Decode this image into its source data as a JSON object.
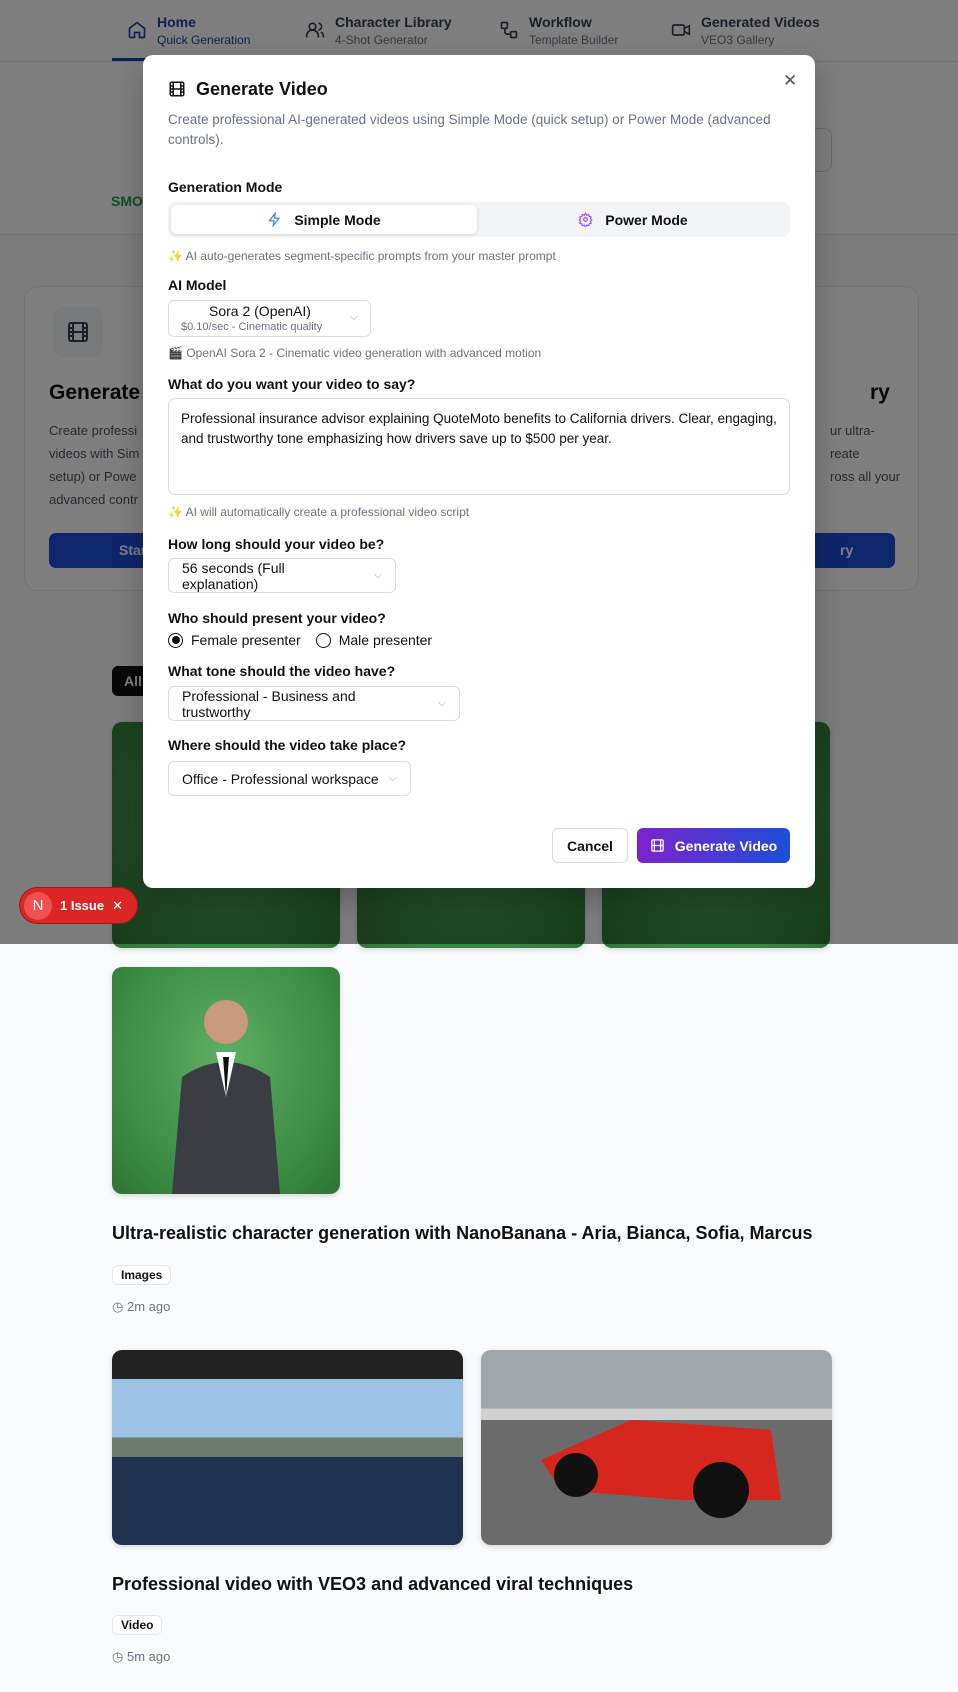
{
  "nav": {
    "items": [
      {
        "title": "Home",
        "subtitle": "Quick Generation",
        "icon": "home-icon"
      },
      {
        "title": "Character Library",
        "subtitle": "4-Shot Generator",
        "icon": "users-icon"
      },
      {
        "title": "Workflow",
        "subtitle": "Template Builder",
        "icon": "workflow-icon"
      },
      {
        "title": "Generated Videos",
        "subtitle": "VEO3 Gallery",
        "icon": "video-icon"
      }
    ]
  },
  "background": {
    "smo_text": "SMO",
    "card_title": "Generate V",
    "card_title_right": "ry",
    "card_desc": [
      "Create professi",
      "videos with Sim",
      "setup) or Powe",
      "advanced contr"
    ],
    "card_desc_right": [
      "ur ultra-",
      "reate",
      "ross all your"
    ],
    "start_button": "Star",
    "library_button": "ry",
    "filter_all": "All"
  },
  "modal": {
    "title": "Generate Video",
    "description": "Create professional AI-generated videos using Simple Mode (quick setup) or Power Mode (advanced controls).",
    "mode_label": "Generation Mode",
    "modes": [
      {
        "label": "Simple Mode",
        "active": true
      },
      {
        "label": "Power Mode",
        "active": false
      }
    ],
    "mode_hint": "AI auto-generates segment-specific prompts from your master prompt",
    "model_label": "AI Model",
    "model_name": "Sora 2 (OpenAI)",
    "model_sub": "$0.10/sec - Cinematic quality",
    "model_hint": "OpenAI Sora 2 - Cinematic video generation with advanced motion",
    "say_label": "What do you want your video to say?",
    "say_value": "Professional insurance advisor explaining QuoteMoto benefits to California drivers. Clear, engaging, and trustworthy tone emphasizing how drivers save up to $500 per year.",
    "say_hint": "AI will automatically create a professional video script",
    "duration_label": "How long should your video be?",
    "duration_value": "56 seconds (Full explanation)",
    "presenter_label": "Who should present your video?",
    "presenters": [
      {
        "label": "Female presenter",
        "checked": true
      },
      {
        "label": "Male presenter",
        "checked": false
      }
    ],
    "tone_label": "What tone should the video have?",
    "tone_value": "Professional - Business and trustworthy",
    "place_label": "Where should the video take place?",
    "place_value": "Office - Professional workspace",
    "cancel": "Cancel",
    "generate": "Generate Video"
  },
  "issue": {
    "letter": "N",
    "label": "1 Issue"
  },
  "feed": [
    {
      "title": "Ultra-realistic character generation with NanoBanana - Aria, Bianca, Sofia, Marcus",
      "badge": "Images",
      "time": "2m ago"
    },
    {
      "title": "Professional video with VEO3 and advanced viral techniques",
      "badge": "Video",
      "time": "5m ago"
    }
  ],
  "colors": {
    "accent": "#1e40af",
    "generate_from": "#7e22ce",
    "generate_to": "#1d4ed8",
    "issue": "#dc2626"
  }
}
